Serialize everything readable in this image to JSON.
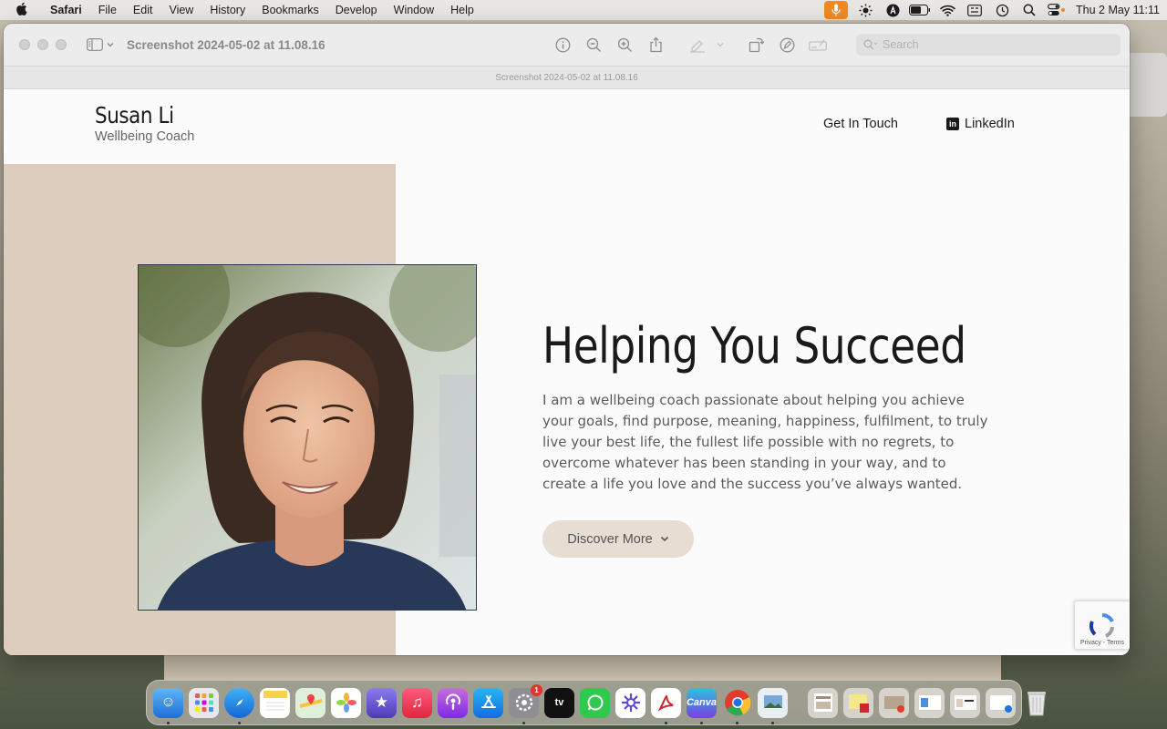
{
  "menubar": {
    "app_name": "Safari",
    "items": [
      "File",
      "Edit",
      "View",
      "History",
      "Bookmarks",
      "Develop",
      "Window",
      "Help"
    ],
    "clock": "Thu 2 May  11:11"
  },
  "preview_window": {
    "title": "Screenshot 2024-05-02 at 11.08.16",
    "tab_title": "Screenshot 2024-05-02 at 11.08.16",
    "search_placeholder": "Search"
  },
  "site": {
    "brand_name": "Susan Li",
    "brand_tagline": "Wellbeing Coach",
    "nav_contact": "Get In Touch",
    "nav_linkedin": "LinkedIn",
    "headline": "Helping You Succeed",
    "body": "I am a wellbeing coach passionate about helping you achieve your goals, find purpose, meaning, happiness, fulfilment, to truly live your best life, the fullest life possible with no regrets, to overcome whatever has been standing in your way, and to create a life you love and the success you’ve always wanted.",
    "cta_label": "Discover More",
    "recaptcha_terms": "Privacy - Terms"
  },
  "dock": {
    "settings_badge": "1",
    "apple_tv_label": "tv",
    "canva_label": "Canva"
  },
  "colors": {
    "beige_panel": "#dccdbc",
    "cta_bg": "#e8ddd3",
    "mic_indicator": "#f08a24"
  }
}
